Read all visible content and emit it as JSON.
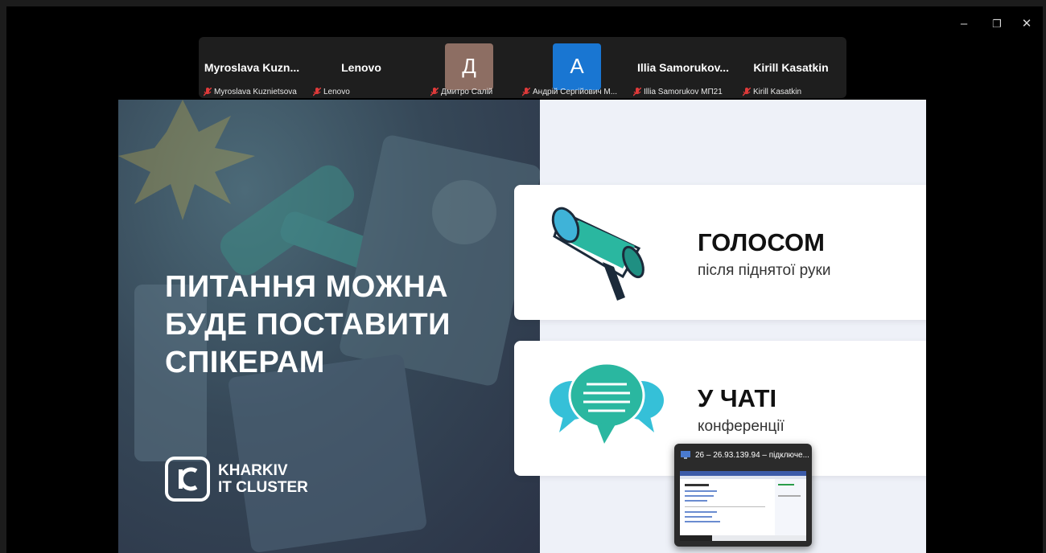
{
  "window": {
    "controls": {
      "minimize": "–",
      "restore": "❐",
      "close": "✕"
    }
  },
  "participants": [
    {
      "display": "Myroslava  Kuzn...",
      "caption": "Myroslava Kuznietsova",
      "type": "name"
    },
    {
      "display": "Lenovo",
      "caption": "Lenovo",
      "type": "name"
    },
    {
      "display": "Д",
      "caption": "Дмитро Салій",
      "type": "avatar",
      "color": "#8d6e63"
    },
    {
      "display": "А",
      "caption": "Андрій Сергійович М...",
      "type": "avatar",
      "color": "#1976d2"
    },
    {
      "display": "Illia  Samorukov...",
      "caption": "Illia Samorukov МП21",
      "type": "name"
    },
    {
      "display": "Kirill Kasatkin",
      "caption": "Kirill Kasatkin",
      "type": "name"
    }
  ],
  "slide": {
    "headline": [
      "ПИТАННЯ МОЖНА",
      "БУДЕ ПОСТАВИТИ",
      "СПІКЕРАМ"
    ],
    "logo": {
      "line1": "KHARKIV",
      "line2": "IT CLUSTER"
    },
    "card_voice": {
      "title": "ГОЛОСОМ",
      "subtitle": "після піднятої руки",
      "icon": "megaphone-icon"
    },
    "card_chat": {
      "title": "У ЧАТІ",
      "subtitle": "конференції",
      "icon": "chat-bubbles-icon"
    }
  },
  "preview": {
    "title": "26 – 26.93.139.94 – підключе..."
  },
  "colors": {
    "accent_teal": "#2ab7a0",
    "chat_cyan": "#35c0d8",
    "muted_red": "#e03a3a"
  }
}
